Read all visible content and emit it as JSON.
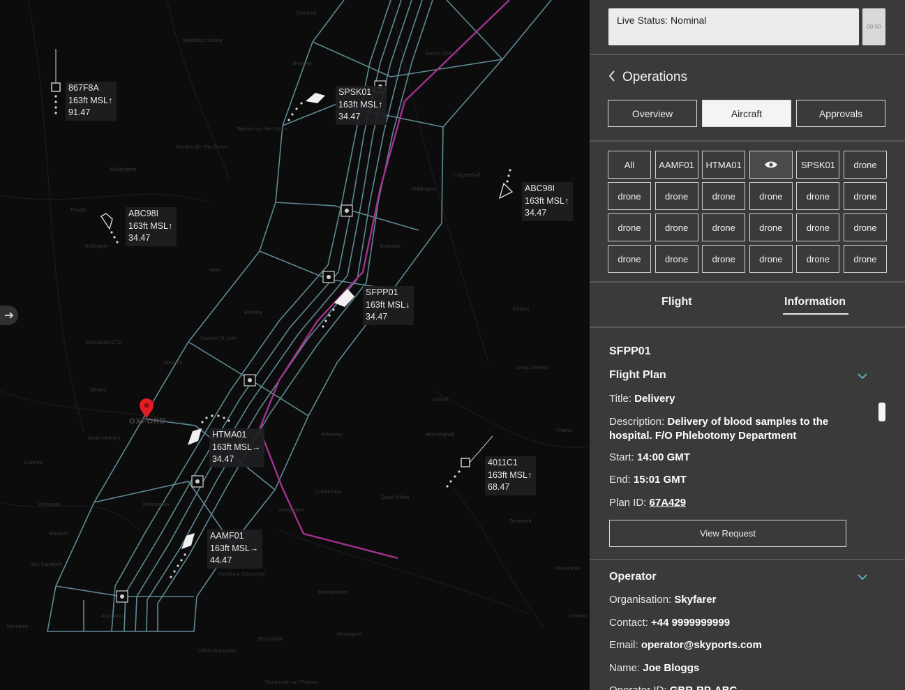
{
  "status": {
    "text": "Live Status: Nominal",
    "time": "00:00"
  },
  "operations": {
    "back_icon": "chevron-left-icon",
    "title": "Operations",
    "tabs": [
      {
        "label": "Overview",
        "active": false
      },
      {
        "label": "Aircraft",
        "active": true
      },
      {
        "label": "Approvals",
        "active": false
      }
    ]
  },
  "aircraft_filter": {
    "chips": [
      "All",
      "AAMF01",
      "HTMA01",
      "eye-icon",
      "SPSK01",
      "drone",
      "drone",
      "drone",
      "drone",
      "drone",
      "drone",
      "drone",
      "drone",
      "drone",
      "drone",
      "drone",
      "drone",
      "drone",
      "drone",
      "drone",
      "drone",
      "drone",
      "drone",
      "drone"
    ]
  },
  "detail_tabs": {
    "flight": "Flight",
    "information": "Information",
    "active": "information"
  },
  "flight": {
    "id": "SFPP01",
    "plan_title": "Flight Plan",
    "title_label": "Title:",
    "title_value": "Delivery",
    "desc_label": "Description:",
    "desc_value_1": "Delivery of blood samples to the",
    "desc_value_2": "hospital. F/O Phlebotomy Department",
    "start_label": "Start:",
    "start_value": "14:00 GMT",
    "end_label": "End:",
    "end_value": "15:01 GMT",
    "plan_id_label": "Plan ID:",
    "plan_id_value": "67A429",
    "view_request": "View Request"
  },
  "operator": {
    "title": "Operator",
    "org_label": "Organisation:",
    "org_value": "Skyfarer",
    "contact_label": "Contact:",
    "contact_value": "+44 9999999999",
    "email_label": "Email:",
    "email_value": "operator@skyports.com",
    "name_label": "Name:",
    "name_value": "Joe Bloggs",
    "opid_label": "Operator ID:",
    "opid_value": "GBR-RP-ABC"
  },
  "map": {
    "city_label": "OXFORD",
    "aircraft": [
      {
        "id": "867F8A",
        "alt": "163ft MSL↑",
        "val": "91.47"
      },
      {
        "id": "SPSK01",
        "alt": "163ft MSL↑",
        "val": "34.47"
      },
      {
        "id": "ABC98I",
        "alt": "163ft MSL↑",
        "val": "34.47"
      },
      {
        "id": "ABC98I",
        "alt": "163ft MSL↑",
        "val": "34.47"
      },
      {
        "id": "SFPP01",
        "alt": "163ft MSL↓",
        "val": "34.47"
      },
      {
        "id": "HTMA01",
        "alt": "163ft MSL→",
        "val": "34.47"
      },
      {
        "id": "4011C1",
        "alt": "163ft MSL↑",
        "val": "68.47"
      },
      {
        "id": "AAMF01",
        "alt": "163ft MSL→",
        "val": "44.47"
      }
    ],
    "colors": {
      "corridor": "#5f8a94",
      "route": "#a6318f",
      "marker": "#e31b23",
      "background": "#0c0c0d"
    }
  }
}
